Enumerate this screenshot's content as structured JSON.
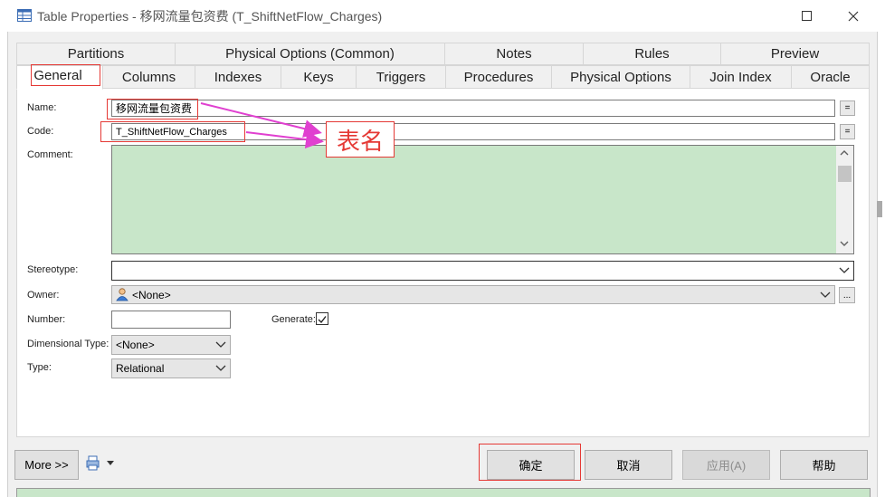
{
  "window": {
    "title": "Table Properties - 移网流量包资费 (T_ShiftNetFlow_Charges)"
  },
  "tabs_row1": [
    "Partitions",
    "Physical Options (Common)",
    "Notes",
    "Rules",
    "Preview"
  ],
  "tabs_row2": [
    "General",
    "Columns",
    "Indexes",
    "Keys",
    "Triggers",
    "Procedures",
    "Physical Options",
    "Join Index",
    "Oracle"
  ],
  "active_tab": "General",
  "form": {
    "name_label": "Name:",
    "name_value": "移网流量包资费",
    "code_label": "Code:",
    "code_value": "T_ShiftNetFlow_Charges",
    "comment_label": "Comment:",
    "stereotype_label": "Stereotype:",
    "stereotype_value": "",
    "owner_label": "Owner:",
    "owner_value": "<None>",
    "number_label": "Number:",
    "number_value": "",
    "generate_label": "Generate:",
    "generate_checked": true,
    "dimensional_type_label": "Dimensional Type:",
    "dimensional_type_value": "<None>",
    "type_label": "Type:",
    "type_value": "Relational",
    "eq_button": "=",
    "ellipsis_button": "..."
  },
  "annotation": {
    "text": "表名",
    "color": "#e53935",
    "arrow_color": "#e040d0"
  },
  "buttons": {
    "more": "More >>",
    "ok": "确定",
    "cancel": "取消",
    "apply": "应用(A)",
    "help": "帮助"
  },
  "colors": {
    "comment_bg": "#c8e6c9",
    "highlight": "#e53935"
  }
}
